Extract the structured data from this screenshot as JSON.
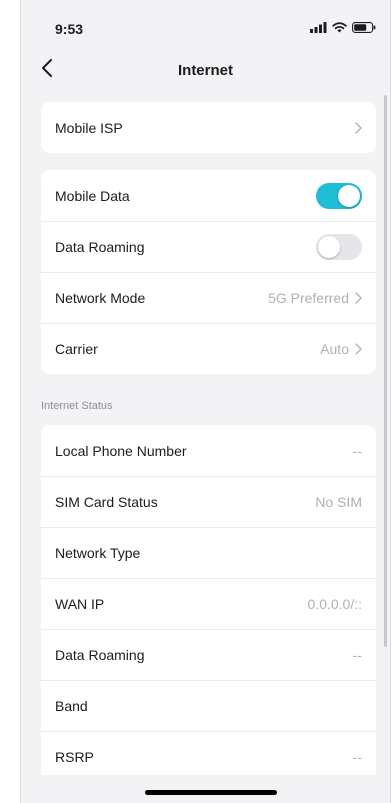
{
  "status_bar": {
    "time": "9:53"
  },
  "nav": {
    "title": "Internet"
  },
  "isp_card": {
    "label": "Mobile ISP"
  },
  "data_card": {
    "mobile_data": {
      "label": "Mobile Data",
      "enabled": true
    },
    "data_roaming": {
      "label": "Data Roaming",
      "enabled": false
    },
    "network_mode": {
      "label": "Network Mode",
      "value": "5G Preferred"
    },
    "carrier": {
      "label": "Carrier",
      "value": "Auto"
    }
  },
  "status_section": {
    "header": "Internet Status",
    "rows": [
      {
        "label": "Local Phone Number",
        "value": "--"
      },
      {
        "label": "SIM Card Status",
        "value": "No SIM"
      },
      {
        "label": "Network Type",
        "value": ""
      },
      {
        "label": "WAN IP",
        "value": "0.0.0.0/::"
      },
      {
        "label": "Data Roaming",
        "value": "--"
      },
      {
        "label": "Band",
        "value": ""
      },
      {
        "label": "RSRP",
        "value": "--"
      }
    ]
  },
  "colors": {
    "accent": "#1fbcd6",
    "background": "#f3f3f5",
    "muted_text": "#b0b0b5"
  },
  "icons": {
    "back": "chevron-left-icon",
    "disclosure": "chevron-right-icon",
    "signal": "signal-icon",
    "wifi": "wifi-icon",
    "battery": "battery-icon"
  }
}
